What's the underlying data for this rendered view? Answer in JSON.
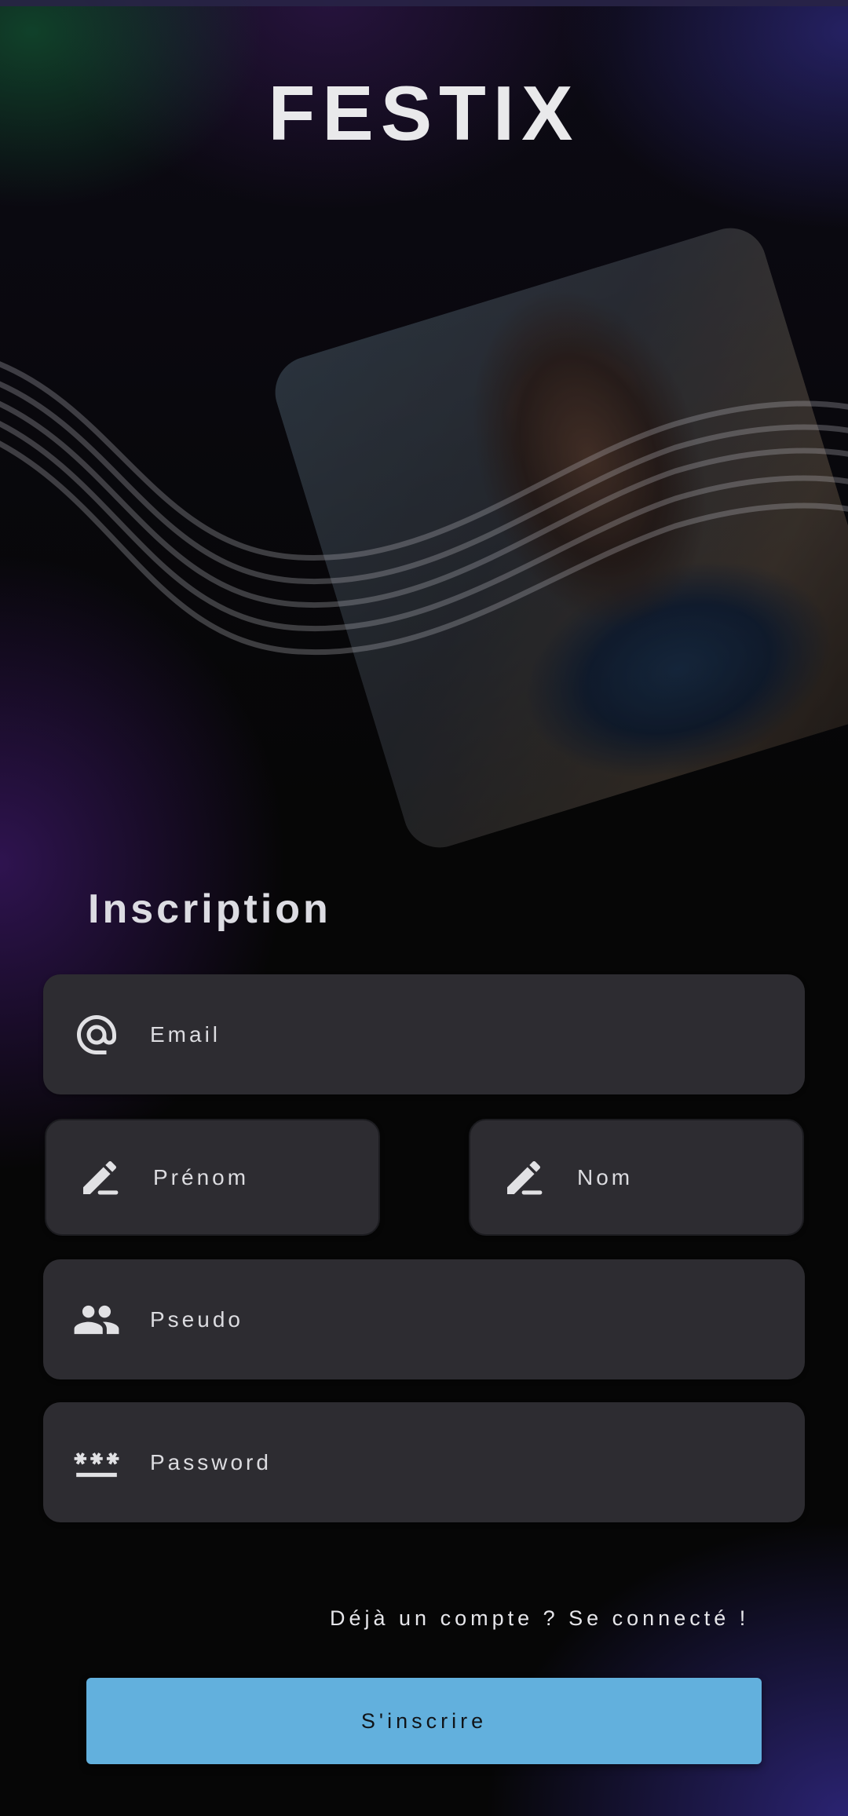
{
  "app": {
    "title": "FESTIX"
  },
  "hero": {
    "image_icon": "concert-photo"
  },
  "form": {
    "title": "Inscription",
    "fields": {
      "email": {
        "placeholder": "Email",
        "icon": "at-sign-icon"
      },
      "prenom": {
        "placeholder": "Prénom",
        "icon": "pencil-icon"
      },
      "nom": {
        "placeholder": "Nom",
        "icon": "pencil-icon"
      },
      "pseudo": {
        "placeholder": "Pseudo",
        "icon": "people-icon"
      },
      "password": {
        "placeholder": "Password",
        "icon": "password-icon"
      }
    },
    "login_link": "Déjà un compte ? Se connecté !",
    "submit_label": "S'inscrire"
  },
  "colors": {
    "accent": "#62b0dd",
    "field_bg": "#2d2c31",
    "background": "#070707"
  }
}
